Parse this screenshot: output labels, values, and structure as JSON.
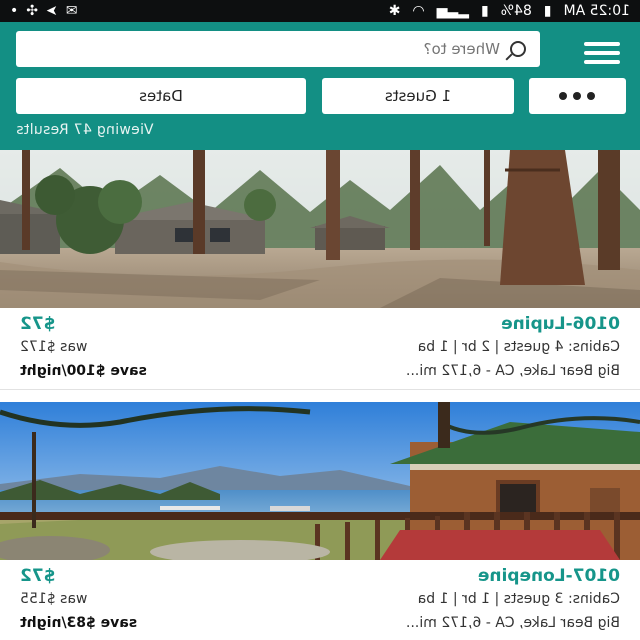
{
  "status_bar": {
    "time": "10:25 AM",
    "battery": "84%"
  },
  "header": {
    "search_placeholder": "Where to?",
    "dates_label": "Dates",
    "guests_label": "1 Guests",
    "results_text": "Viewing 47 Results"
  },
  "listings": [
    {
      "name": "0106-Lupine",
      "details": "Cabins: 4 guests | 2 br | 1 ba",
      "location": "Big Bear Lake, CA - 6,172 mi...",
      "price": "$72",
      "was": "was $172",
      "save": "save $100/night"
    },
    {
      "name": "0107-Lonepine",
      "details": "Cabins: 3 guests | 1 br | 1 ba",
      "location": "Big Bear Lake, CA - 6,172 mi...",
      "price": "$72",
      "was": "was $155",
      "save": "save $83/night"
    }
  ],
  "colors": {
    "header_bg": "#138f84",
    "accent_text": "#16958a"
  }
}
